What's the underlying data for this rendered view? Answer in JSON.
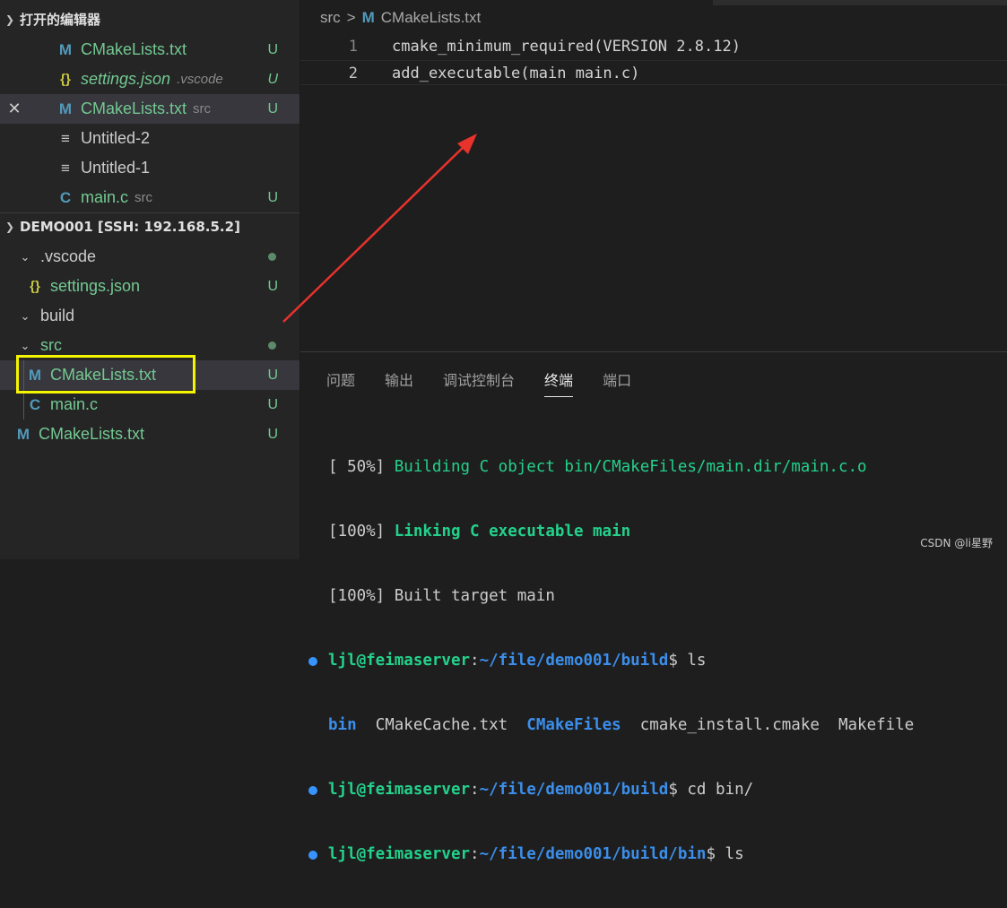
{
  "sidebar": {
    "open_editors": {
      "title": "打开的编辑器",
      "items": [
        {
          "icon": "M",
          "name": "CMakeLists.txt",
          "desc": "",
          "status": "U"
        },
        {
          "icon": "{}",
          "name": "settings.json",
          "desc": ".vscode",
          "status": "U"
        },
        {
          "icon": "M",
          "name": "CMakeLists.txt",
          "desc": "src",
          "status": "U",
          "close": "✕"
        },
        {
          "icon": "≡",
          "name": "Untitled-2",
          "desc": "",
          "status": ""
        },
        {
          "icon": "≡",
          "name": "Untitled-1",
          "desc": "",
          "status": ""
        },
        {
          "icon": "C",
          "name": "main.c",
          "desc": "src",
          "status": "U"
        }
      ]
    },
    "explorer": {
      "title": "DEMO001 [SSH: 192.168.5.2]",
      "items": [
        {
          "name": ".vscode",
          "status": ""
        },
        {
          "icon": "{}",
          "name": "settings.json",
          "status": "U"
        },
        {
          "name": "build",
          "status": ""
        },
        {
          "name": "src",
          "status": ""
        },
        {
          "icon": "M",
          "name": "CMakeLists.txt",
          "status": "U"
        },
        {
          "icon": "C",
          "name": "main.c",
          "status": "U"
        },
        {
          "icon": "M",
          "name": "CMakeLists.txt",
          "status": "U"
        }
      ]
    }
  },
  "editor": {
    "breadcrumb": {
      "folder": "src",
      "separator": ">",
      "file_icon": "M",
      "file": "CMakeLists.txt"
    },
    "lines": [
      {
        "num": "1",
        "text": "cmake_minimum_required(VERSION 2.8.12)"
      },
      {
        "num": "2",
        "text": "add_executable(main main.c)"
      }
    ]
  },
  "panel": {
    "tabs": [
      "问题",
      "输出",
      "调试控制台",
      "终端",
      "端口"
    ],
    "active_tab": "终端",
    "terminal": {
      "l1_pct": "[ 50%]",
      "l1_msg": "Building C object bin/CMakeFiles/main.dir/main.c.o",
      "l2_pct": "[100%]",
      "l2_msg": "Linking C executable main",
      "l3_pct": "[100%]",
      "l3_msg": "Built target main",
      "p1_user": "ljl@feimaserver",
      "p1_colon": ":",
      "p1_path": "~/file/demo001/build",
      "p1_cmd": "$ ls",
      "ls_bin": "bin",
      "ls_cache": "CMakeCache.txt",
      "ls_files": "CMakeFiles",
      "ls_install": "cmake_install.cmake",
      "ls_make": "Makefile",
      "p2_user": "ljl@feimaserver",
      "p2_colon": ":",
      "p2_path": "~/file/demo001/build",
      "p2_cmd": "$ cd bin/",
      "p3_user": "ljl@feimaserver",
      "p3_colon": ":",
      "p3_path": "~/file/demo001/build/bin",
      "p3_cmd": "$ ls"
    }
  },
  "watermark": "CSDN @li星野",
  "colors": {
    "accent": "#3794ff",
    "modified": "#73c991",
    "highlight": "#f6f500",
    "arrow": "#e8322c"
  }
}
